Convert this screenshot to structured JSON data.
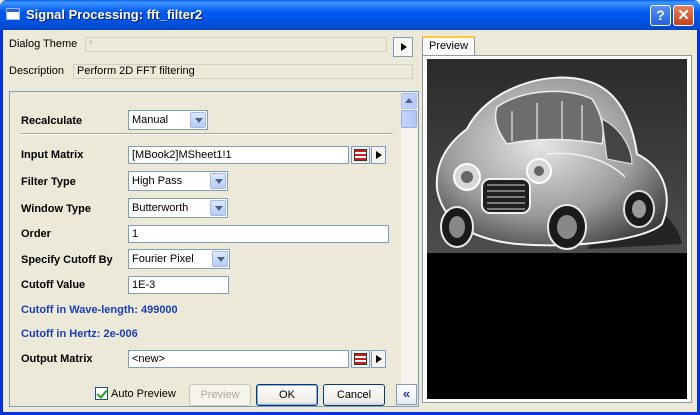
{
  "window": {
    "title": "Signal Processing: fft_filter2",
    "help_glyph": "?",
    "close_glyph": "✕"
  },
  "header": {
    "theme_label": "Dialog Theme",
    "theme_value": "*",
    "description_label": "Description",
    "description_value": "Perform 2D FFT filtering"
  },
  "settings": {
    "recalculate": {
      "label": "Recalculate",
      "value": "Manual"
    },
    "input_matrix": {
      "label": "Input Matrix",
      "value": "[MBook2]MSheet1!1"
    },
    "filter_type": {
      "label": "Filter Type",
      "value": "High Pass"
    },
    "window_type": {
      "label": "Window Type",
      "value": "Butterworth"
    },
    "order": {
      "label": "Order",
      "value": "1"
    },
    "specify_cutoff": {
      "label": "Specify Cutoff By",
      "value": "Fourier Pixel"
    },
    "cutoff_value": {
      "label": "Cutoff Value",
      "value": "1E-3"
    },
    "cutoff_wavelength": "Cutoff in Wave-length: 499000",
    "cutoff_hertz": "Cutoff in Hertz: 2e-006",
    "output_matrix": {
      "label": "Output Matrix",
      "value": "<new>"
    }
  },
  "footer": {
    "auto_preview_label": "Auto Preview",
    "auto_preview_checked": true,
    "preview_button": "Preview",
    "ok_button": "OK",
    "cancel_button": "Cancel",
    "collapse_glyph": "«"
  },
  "preview": {
    "tab_label": "Preview"
  },
  "colors": {
    "title_bar": "#0054e3",
    "accent_text": "#1a3fb8",
    "tab_highlight": "#ffc83c"
  },
  "icons": [
    "window-icon",
    "help-icon",
    "close-icon",
    "arrow-right-icon",
    "dropdown-arrow-icon",
    "range-picker-icon",
    "scroll-up-icon",
    "scroll-down-icon",
    "collapse-icon"
  ]
}
